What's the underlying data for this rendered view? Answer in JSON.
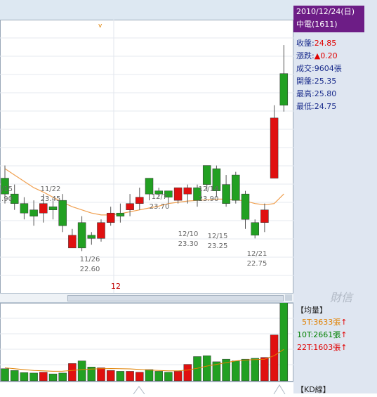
{
  "info": {
    "date": "2010/12/24(日)",
    "stock": "中電(1611)",
    "close_label": "收盤:",
    "close": "24.85",
    "change_label": "漲跌:",
    "change": "0.20",
    "volume_label": "成交:",
    "volume": "9604張",
    "open_label": "開盤:",
    "open": "25.35",
    "high_label": "最高:",
    "high": "25.80",
    "low_label": "最低:",
    "low": "24.75"
  },
  "watermark": "財信",
  "volume_panel": {
    "title": "【均量】",
    "ma5": "5T:3633張",
    "ma10": "10T:2661張",
    "ma20": "22T:1603張",
    "arrow": "↑"
  },
  "kd_panel": {
    "title": "【KD線】"
  },
  "cursor_marker": "v",
  "month_label": "12",
  "price_labels": [
    {
      "date": "/15",
      "price": ".90"
    },
    {
      "date": "11/22",
      "price": "23.45"
    },
    {
      "date": "11/26",
      "price": "22.60"
    },
    {
      "date": "12/7",
      "price": "23.70"
    },
    {
      "date": "12/14",
      "price": "23.90"
    },
    {
      "date": "12/10",
      "price": "23.30"
    },
    {
      "date": "12/15",
      "price": "23.25"
    },
    {
      "date": "12/21",
      "price": "22.75"
    }
  ],
  "colors": {
    "up": "#e01010",
    "down": "#22a022",
    "ma": "#f0a050",
    "panel_head": "#6d1d86",
    "info_text": "#1a2c8c"
  },
  "chart_data": {
    "type": "candlestick",
    "price_range": [
      21.9,
      26.2
    ],
    "candles": [
      {
        "o": 23.7,
        "h": 23.9,
        "l": 23.3,
        "c": 23.45
      },
      {
        "o": 23.45,
        "h": 23.6,
        "l": 23.2,
        "c": 23.3
      },
      {
        "o": 23.3,
        "h": 23.4,
        "l": 23.05,
        "c": 23.15
      },
      {
        "o": 23.2,
        "h": 23.35,
        "l": 22.95,
        "c": 23.1
      },
      {
        "o": 23.15,
        "h": 23.45,
        "l": 23.0,
        "c": 23.3
      },
      {
        "o": 23.25,
        "h": 23.35,
        "l": 23.05,
        "c": 23.2
      },
      {
        "o": 23.35,
        "h": 23.45,
        "l": 22.85,
        "c": 22.95
      },
      {
        "o": 22.6,
        "h": 22.9,
        "l": 22.6,
        "c": 22.8
      },
      {
        "o": 23.0,
        "h": 23.1,
        "l": 22.55,
        "c": 22.6
      },
      {
        "o": 22.8,
        "h": 22.85,
        "l": 22.65,
        "c": 22.75
      },
      {
        "o": 22.75,
        "h": 23.05,
        "l": 22.7,
        "c": 23.0
      },
      {
        "o": 23.0,
        "h": 23.25,
        "l": 22.95,
        "c": 23.15
      },
      {
        "o": 23.15,
        "h": 23.3,
        "l": 23.0,
        "c": 23.1
      },
      {
        "o": 23.2,
        "h": 23.45,
        "l": 23.1,
        "c": 23.3
      },
      {
        "o": 23.3,
        "h": 23.55,
        "l": 23.2,
        "c": 23.4
      },
      {
        "o": 23.7,
        "h": 23.7,
        "l": 23.35,
        "c": 23.45
      },
      {
        "o": 23.5,
        "h": 23.55,
        "l": 23.4,
        "c": 23.45
      },
      {
        "o": 23.5,
        "h": 23.5,
        "l": 23.3,
        "c": 23.4
      },
      {
        "o": 23.35,
        "h": 23.55,
        "l": 23.3,
        "c": 23.55
      },
      {
        "o": 23.45,
        "h": 23.6,
        "l": 23.3,
        "c": 23.55
      },
      {
        "o": 23.55,
        "h": 23.6,
        "l": 23.25,
        "c": 23.35
      },
      {
        "o": 23.9,
        "h": 23.9,
        "l": 23.5,
        "c": 23.6
      },
      {
        "o": 23.85,
        "h": 23.9,
        "l": 23.4,
        "c": 23.5
      },
      {
        "o": 23.6,
        "h": 23.75,
        "l": 23.25,
        "c": 23.3
      },
      {
        "o": 23.75,
        "h": 23.8,
        "l": 23.3,
        "c": 23.35
      },
      {
        "o": 23.45,
        "h": 23.5,
        "l": 22.9,
        "c": 23.05
      },
      {
        "o": 23.0,
        "h": 23.05,
        "l": 22.75,
        "c": 22.8
      },
      {
        "o": 23.0,
        "h": 23.3,
        "l": 22.85,
        "c": 23.2
      },
      {
        "o": 23.7,
        "h": 24.85,
        "l": 23.7,
        "c": 24.65
      },
      {
        "o": 25.35,
        "h": 25.8,
        "l": 24.75,
        "c": 24.85
      }
    ],
    "ma": [
      23.85,
      23.75,
      23.65,
      23.55,
      23.48,
      23.4,
      23.32,
      23.25,
      23.2,
      23.15,
      23.12,
      23.12,
      23.14,
      23.17,
      23.2,
      23.23,
      23.26,
      23.3,
      23.32,
      23.34,
      23.35,
      23.36,
      23.37,
      23.37,
      23.36,
      23.34,
      23.3,
      23.28,
      23.3,
      23.45
    ],
    "volume_range": [
      0,
      9000
    ],
    "volumes": [
      1400,
      1200,
      950,
      900,
      1000,
      800,
      900,
      2000,
      2300,
      1600,
      1500,
      1200,
      1100,
      1100,
      1000,
      1300,
      1100,
      1000,
      1100,
      1900,
      2800,
      2900,
      2200,
      2500,
      2300,
      2500,
      2600,
      2700,
      5300,
      9604
    ],
    "vol_ma": [
      1500,
      1400,
      1300,
      1200,
      1150,
      1100,
      1120,
      1200,
      1300,
      1350,
      1400,
      1420,
      1400,
      1380,
      1320,
      1250,
      1200,
      1150,
      1150,
      1250,
      1450,
      1700,
      1900,
      2100,
      2300,
      2400,
      2450,
      2500,
      2900,
      3633
    ]
  }
}
